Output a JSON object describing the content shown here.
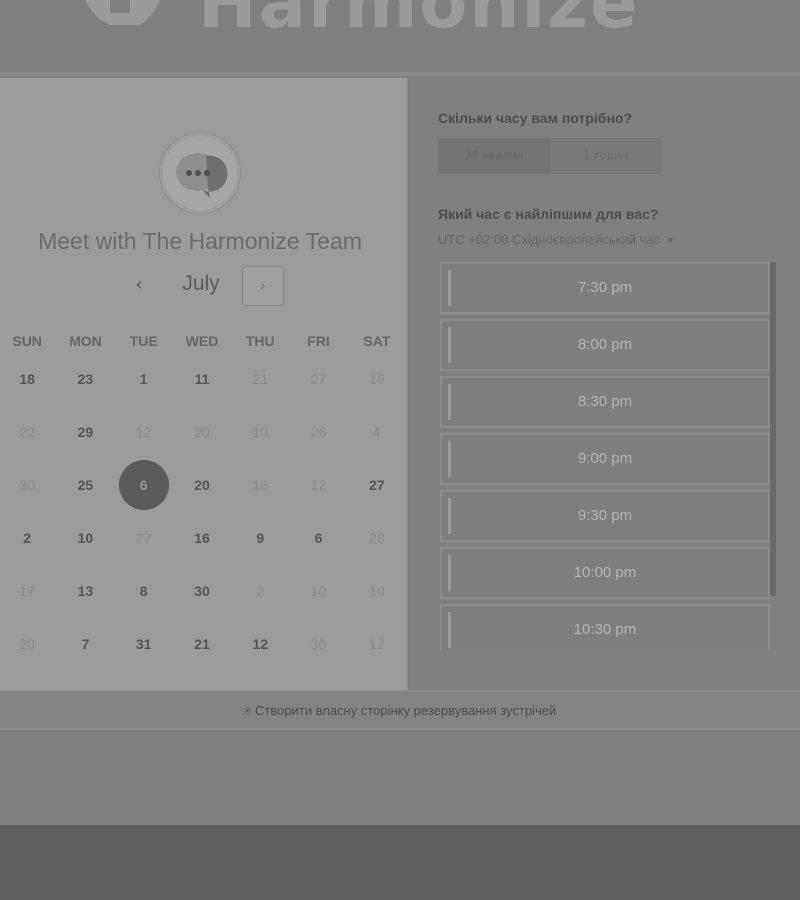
{
  "brand": {
    "name": "Harmonize",
    "logo_icon": "harmonize-logo-icon"
  },
  "scheduler": {
    "title": "Meet with The Harmonize Team",
    "avatar_icon": "chat-bubble-dots-icon",
    "month": "July",
    "prev_icon": "‹",
    "next_icon": "›",
    "weekdays": [
      "SUN",
      "MON",
      "TUE",
      "WED",
      "THU",
      "FRI",
      "SAT"
    ],
    "weeks": [
      [
        {
          "d": "18",
          "s": "active"
        },
        {
          "d": "23",
          "s": "active"
        },
        {
          "d": "1",
          "s": "active"
        },
        {
          "d": "11",
          "s": "active"
        },
        {
          "d": "21",
          "s": "disabled"
        },
        {
          "d": "27",
          "s": "disabled"
        },
        {
          "d": "16",
          "s": "disabled"
        }
      ],
      [
        {
          "d": "22",
          "s": "disabled"
        },
        {
          "d": "29",
          "s": "active"
        },
        {
          "d": "12",
          "s": "disabled"
        },
        {
          "d": "20",
          "s": "disabled"
        },
        {
          "d": "10",
          "s": "disabled"
        },
        {
          "d": "26",
          "s": "disabled"
        },
        {
          "d": "4",
          "s": "disabled"
        }
      ],
      [
        {
          "d": "30",
          "s": "disabled"
        },
        {
          "d": "25",
          "s": "active"
        },
        {
          "d": "6",
          "s": "selected"
        },
        {
          "d": "20",
          "s": "active"
        },
        {
          "d": "16",
          "s": "disabled"
        },
        {
          "d": "12",
          "s": "disabled"
        },
        {
          "d": "27",
          "s": "active"
        }
      ],
      [
        {
          "d": "2",
          "s": "active"
        },
        {
          "d": "10",
          "s": "active"
        },
        {
          "d": "27",
          "s": "disabled"
        },
        {
          "d": "16",
          "s": "active"
        },
        {
          "d": "9",
          "s": "active"
        },
        {
          "d": "6",
          "s": "active"
        },
        {
          "d": "28",
          "s": "disabled"
        }
      ],
      [
        {
          "d": "17",
          "s": "disabled"
        },
        {
          "d": "13",
          "s": "active"
        },
        {
          "d": "8",
          "s": "active"
        },
        {
          "d": "30",
          "s": "active"
        },
        {
          "d": "2",
          "s": "disabled"
        },
        {
          "d": "10",
          "s": "disabled"
        },
        {
          "d": "10",
          "s": "disabled"
        }
      ],
      [
        {
          "d": "20",
          "s": "disabled"
        },
        {
          "d": "7",
          "s": "active"
        },
        {
          "d": "31",
          "s": "active"
        },
        {
          "d": "21",
          "s": "active"
        },
        {
          "d": "12",
          "s": "active"
        },
        {
          "d": "30",
          "s": "disabled"
        },
        {
          "d": "17",
          "s": "disabled"
        }
      ]
    ]
  },
  "booking": {
    "duration_question": "Скільки часу вам потрібно?",
    "durations": [
      {
        "label": "30 хвилин",
        "active": true
      },
      {
        "label": "1 годин",
        "active": false
      }
    ],
    "time_question": "Який час є найліпшим для вас?",
    "timezone": "UTC +02:00 Східноєвропейський час",
    "timezone_caret": "▼",
    "slots": [
      "7:30 pm",
      "8:00 pm",
      "8:30 pm",
      "9:00 pm",
      "9:30 pm",
      "10:00 pm",
      "10:30 pm"
    ]
  },
  "footer": {
    "link_label": "Створити власну сторінку резервування зустрічей",
    "link_icon": "harmonize-small-icon"
  }
}
